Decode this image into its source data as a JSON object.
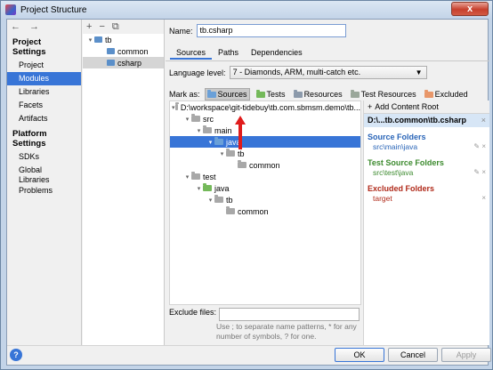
{
  "window": {
    "title": "Project Structure",
    "close": "x"
  },
  "nav": {
    "back_arrow": "←",
    "forward_arrow": "→",
    "project_settings_heading": "Project Settings",
    "project_settings": [
      "Project",
      "Modules",
      "Libraries",
      "Facets",
      "Artifacts"
    ],
    "platform_settings_heading": "Platform Settings",
    "platform_settings": [
      "SDKs",
      "Global Libraries"
    ],
    "problems": "Problems",
    "selected": "Modules"
  },
  "modules": {
    "toolbar": {
      "add": "+",
      "remove": "−",
      "copy": "⧉"
    },
    "tree": [
      {
        "label": "tb",
        "indent": 0,
        "twisty": "▾"
      },
      {
        "label": "common",
        "indent": 1,
        "twisty": ""
      },
      {
        "label": "csharp",
        "indent": 1,
        "twisty": "",
        "selected": true
      }
    ]
  },
  "main": {
    "name_label": "Name:",
    "name_value": "tb.csharp",
    "tabs": [
      "Sources",
      "Paths",
      "Dependencies"
    ],
    "active_tab": "Sources",
    "language_label": "Language level:",
    "language_value": "7 - Diamonds, ARM, multi-catch etc.",
    "mark_as_label": "Mark as:",
    "mark_buttons": [
      {
        "label": "Sources",
        "color": "#6aa0d8",
        "pressed": true
      },
      {
        "label": "Tests",
        "color": "#74b95a",
        "pressed": false
      },
      {
        "label": "Resources",
        "color": "#8c9aab",
        "pressed": false
      },
      {
        "label": "Test Resources",
        "color": "#9aa79a",
        "pressed": false
      },
      {
        "label": "Excluded",
        "color": "#e8976a",
        "pressed": false
      }
    ],
    "tree": [
      {
        "label": "D:\\workspace\\git-tidebuy\\tb.com.sbmsm.demo\\tb...",
        "indent": 0,
        "twisty": "▾",
        "folder": "gray"
      },
      {
        "label": "src",
        "indent": 1,
        "twisty": "▾",
        "folder": "gray"
      },
      {
        "label": "main",
        "indent": 2,
        "twisty": "▾",
        "folder": "gray"
      },
      {
        "label": "java",
        "indent": 3,
        "twisty": "▾",
        "folder": "blue",
        "selected": true
      },
      {
        "label": "tb",
        "indent": 4,
        "twisty": "▾",
        "folder": "gray"
      },
      {
        "label": "common",
        "indent": 5,
        "twisty": "",
        "folder": "gray"
      },
      {
        "label": "test",
        "indent": 1,
        "twisty": "▾",
        "folder": "gray"
      },
      {
        "label": "java",
        "indent": 2,
        "twisty": "▾",
        "folder": "green"
      },
      {
        "label": "tb",
        "indent": 3,
        "twisty": "▾",
        "folder": "gray"
      },
      {
        "label": "common",
        "indent": 4,
        "twisty": "",
        "folder": "gray"
      }
    ],
    "exclude_label": "Exclude files:",
    "exclude_value": "",
    "exclude_hint": "Use ; to separate name patterns, * for any number of symbols, ? for one."
  },
  "roots": {
    "add_label": "Add Content Root",
    "header": "D:\\...tb.common\\tb.csharp",
    "source_title": "Source Folders",
    "source_path": "src\\main\\java",
    "test_title": "Test Source Folders",
    "test_path": "src\\test\\java",
    "excluded_title": "Excluded Folders",
    "excluded_path": "target",
    "edit_icon": "✎",
    "remove_icon": "×"
  },
  "footer": {
    "help": "?",
    "ok": "OK",
    "cancel": "Cancel",
    "apply": "Apply"
  },
  "colors": {
    "selection": "#3875d7",
    "annotation_arrow": "#e01c1c"
  }
}
